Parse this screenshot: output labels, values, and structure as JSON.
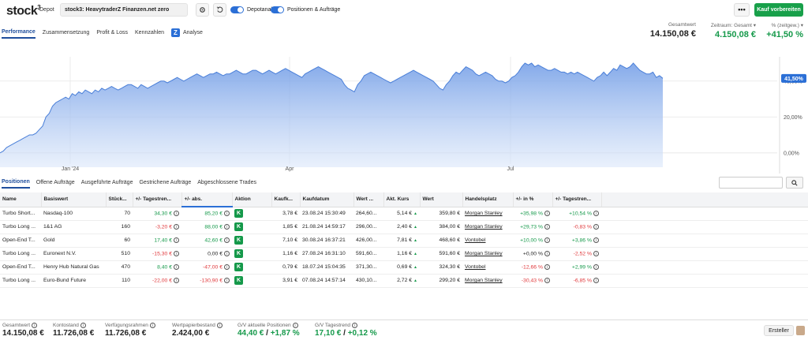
{
  "header": {
    "logo": "stock",
    "logo_sup": "3",
    "depot_label": "Depot",
    "depot_name": "stock3: HeavytraderZ Finanzen.net zero",
    "toggle1_label": "Depotanalyse",
    "toggle2_label": "Positionen & Aufträge",
    "more_label": "•••",
    "buy_label": "Kauf vorbereiten"
  },
  "tabs": [
    "Performance",
    "Zusammensetzung",
    "Profit & Loss",
    "Kennzahlen",
    "Analyse"
  ],
  "analyse_icon_letter": "Z",
  "kpis": {
    "gesamtwert_label": "Gesamtwert",
    "gesamtwert": "14.150,08 €",
    "zeitraum_label": "Zeitraum: Gesamt ▾",
    "zeitraum": "4.150,08 €",
    "prozent_label": "% (zeitgew.) ▾",
    "prozent": "+41,50 %"
  },
  "chart_data": {
    "type": "area",
    "x_ticks": [
      "Jan '24",
      "Apr",
      "Jul"
    ],
    "y_ticks": [
      "40,00%",
      "20,00%",
      "0,00%"
    ],
    "last_value_label": "41,50%",
    "ylim": [
      -8,
      50
    ],
    "values": [
      0,
      1,
      3,
      4,
      5,
      6,
      7,
      8,
      9,
      10,
      10,
      11,
      13,
      15,
      20,
      22,
      26,
      28,
      29,
      30,
      31,
      30,
      33,
      32,
      34,
      33,
      35,
      34,
      33,
      35,
      34,
      36,
      35,
      36,
      37,
      36,
      35,
      36,
      37,
      38,
      38,
      37,
      36,
      38,
      37,
      36,
      37,
      38,
      39,
      40,
      40,
      39,
      40,
      41,
      42,
      41,
      40,
      41,
      42,
      43,
      44,
      43,
      42,
      43,
      44,
      44,
      45,
      44,
      43,
      44,
      44,
      45,
      46,
      45,
      44,
      44,
      45,
      46,
      46,
      45,
      44,
      45,
      46,
      45,
      44,
      45,
      46,
      47,
      46,
      45,
      44,
      43,
      42,
      44,
      45,
      46,
      47,
      48,
      47,
      46,
      45,
      44,
      43,
      42,
      41,
      38,
      36,
      35,
      34,
      38,
      40,
      43,
      44,
      45,
      44,
      43,
      42,
      41,
      40,
      39,
      40,
      41,
      42,
      43,
      44,
      45,
      46,
      45,
      44,
      43,
      42,
      41,
      40,
      38,
      36,
      35,
      38,
      40,
      43,
      45,
      44,
      46,
      48,
      47,
      46,
      44,
      43,
      44,
      45,
      44,
      43,
      41,
      40,
      40,
      39,
      40,
      42,
      43,
      45,
      48,
      50,
      49,
      50,
      48,
      49,
      48,
      47,
      46,
      46,
      47,
      46,
      45,
      45,
      44,
      45,
      44,
      45,
      44,
      43,
      42,
      41,
      40,
      42,
      43,
      45,
      43,
      45,
      47,
      46,
      49,
      48,
      47,
      48,
      50,
      48,
      46,
      45,
      44,
      44,
      45,
      42,
      43,
      41.5
    ]
  },
  "position_tabs": [
    "Positionen",
    "Offene Aufträge",
    "Ausgeführte Aufträge",
    "Gestrichene Aufträge",
    "Abgeschlossene Trades"
  ],
  "table": {
    "headers": [
      "Name",
      "Basiswert",
      "Stück...",
      "+/- Tagestren...",
      "+/- abs.",
      "Aktion",
      "Kaufk...",
      "Kaufdatum",
      "Wert ...",
      "Akt. Kurs",
      "Wert",
      "Handelsplatz",
      "+/- in %",
      "+/- Tagestren..."
    ],
    "action_letter": "K",
    "rows": [
      {
        "name": "Turbo Short...",
        "basis": "Nasdaq-100",
        "stueck": "70",
        "trend": "34,30 €",
        "trend_c": "green",
        "abs": "85,20 €",
        "abs_c": "green",
        "kaufk": "3,78 €",
        "datum": "23.08.24 15:30:49",
        "wert1": "264,60...",
        "kurs": "5,14 €",
        "wert": "359,80 €",
        "platz": "Morgan Stanley",
        "pct": "+35,98 %",
        "pct_c": "green",
        "trend2": "+10,54 %",
        "trend2_c": "green"
      },
      {
        "name": "Turbo Long ...",
        "basis": "1&1 AG",
        "stueck": "160",
        "trend": "-3,20 €",
        "trend_c": "red",
        "abs": "88,00 €",
        "abs_c": "green",
        "kaufk": "1,85 €",
        "datum": "21.08.24 14:59:17",
        "wert1": "296,00...",
        "kurs": "2,40 €",
        "wert": "384,00 €",
        "platz": "Morgan Stanley",
        "pct": "+29,73 %",
        "pct_c": "green",
        "trend2": "-0,83 %",
        "trend2_c": "red"
      },
      {
        "name": "Open-End T...",
        "basis": "Gold",
        "stueck": "60",
        "trend": "17,40 €",
        "trend_c": "green",
        "abs": "42,60 €",
        "abs_c": "green",
        "kaufk": "7,10 €",
        "datum": "30.08.24 16:37:21",
        "wert1": "426,00...",
        "kurs": "7,81 €",
        "wert": "468,60 €",
        "platz": "Vontobel",
        "pct": "+10,00 %",
        "pct_c": "green",
        "trend2": "+3,86 %",
        "trend2_c": "green"
      },
      {
        "name": "Turbo Long ...",
        "basis": "Euronext N.V.",
        "stueck": "510",
        "trend": "-15,30 €",
        "trend_c": "red",
        "abs": "0,00 €",
        "abs_c": "",
        "kaufk": "1,16 €",
        "datum": "27.08.24 16:31:10",
        "wert1": "591,60...",
        "kurs": "1,16 €",
        "wert": "591,60 €",
        "platz": "Morgan Stanley",
        "pct": "+0,00 %",
        "pct_c": "",
        "trend2": "-2,52 %",
        "trend2_c": "red"
      },
      {
        "name": "Open-End T...",
        "basis": "Henry Hub Natural Gas",
        "stueck": "470",
        "trend": "8,40 €",
        "trend_c": "green",
        "abs": "-47,00 €",
        "abs_c": "red",
        "kaufk": "0,79 €",
        "datum": "18.07.24 15:04:35",
        "wert1": "371,30...",
        "kurs": "0,69 €",
        "wert": "324,30 €",
        "platz": "Vontobel",
        "pct": "-12,66 %",
        "pct_c": "red",
        "trend2": "+2,99 %",
        "trend2_c": "green"
      },
      {
        "name": "Turbo Long ...",
        "basis": "Euro-Bund Future",
        "stueck": "110",
        "trend": "-22,00 €",
        "trend_c": "red",
        "abs": "-130,90 €",
        "abs_c": "red",
        "kaufk": "3,91 €",
        "datum": "07.08.24 14:57:14",
        "wert1": "430,10...",
        "kurs": "2,72 €",
        "wert": "299,20 €",
        "platz": "Morgan Stanley",
        "pct": "-30,43 %",
        "pct_c": "red",
        "trend2": "-6,85 %",
        "trend2_c": "red"
      }
    ]
  },
  "footer": {
    "gesamtwert_label": "Gesamtwert",
    "gesamtwert": "14.150,08 €",
    "konto_label": "Kontostand",
    "konto": "11.726,08 €",
    "verf_label": "Verfügungsrahmen",
    "verf": "11.726,08 €",
    "wp_label": "Wertpapierbestand",
    "wp": "2.424,00 €",
    "gv_label": "G/V aktuelle Positionen",
    "gv_abs": "44,40 €",
    "gv_sep": " / ",
    "gv_pct": "+1,87 %",
    "gvt_label": "G/V Tagestrend",
    "gvt_abs": "17,10 €",
    "gvt_pct": "+0,12 %",
    "ersteller": "Ersteller"
  }
}
